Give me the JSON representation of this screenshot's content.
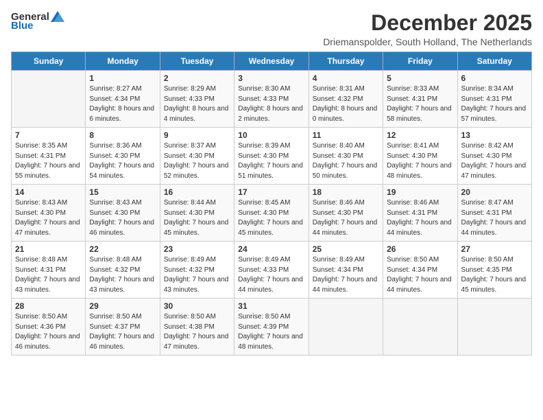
{
  "logo": {
    "general": "General",
    "blue": "Blue"
  },
  "title": "December 2025",
  "subtitle": "Driemanspolder, South Holland, The Netherlands",
  "weekdays": [
    "Sunday",
    "Monday",
    "Tuesday",
    "Wednesday",
    "Thursday",
    "Friday",
    "Saturday"
  ],
  "weeks": [
    [
      {
        "day": "",
        "sunrise": "",
        "sunset": "",
        "daylight": ""
      },
      {
        "day": "1",
        "sunrise": "Sunrise: 8:27 AM",
        "sunset": "Sunset: 4:34 PM",
        "daylight": "Daylight: 8 hours and 6 minutes."
      },
      {
        "day": "2",
        "sunrise": "Sunrise: 8:29 AM",
        "sunset": "Sunset: 4:33 PM",
        "daylight": "Daylight: 8 hours and 4 minutes."
      },
      {
        "day": "3",
        "sunrise": "Sunrise: 8:30 AM",
        "sunset": "Sunset: 4:33 PM",
        "daylight": "Daylight: 8 hours and 2 minutes."
      },
      {
        "day": "4",
        "sunrise": "Sunrise: 8:31 AM",
        "sunset": "Sunset: 4:32 PM",
        "daylight": "Daylight: 8 hours and 0 minutes."
      },
      {
        "day": "5",
        "sunrise": "Sunrise: 8:33 AM",
        "sunset": "Sunset: 4:31 PM",
        "daylight": "Daylight: 7 hours and 58 minutes."
      },
      {
        "day": "6",
        "sunrise": "Sunrise: 8:34 AM",
        "sunset": "Sunset: 4:31 PM",
        "daylight": "Daylight: 7 hours and 57 minutes."
      }
    ],
    [
      {
        "day": "7",
        "sunrise": "Sunrise: 8:35 AM",
        "sunset": "Sunset: 4:31 PM",
        "daylight": "Daylight: 7 hours and 55 minutes."
      },
      {
        "day": "8",
        "sunrise": "Sunrise: 8:36 AM",
        "sunset": "Sunset: 4:30 PM",
        "daylight": "Daylight: 7 hours and 54 minutes."
      },
      {
        "day": "9",
        "sunrise": "Sunrise: 8:37 AM",
        "sunset": "Sunset: 4:30 PM",
        "daylight": "Daylight: 7 hours and 52 minutes."
      },
      {
        "day": "10",
        "sunrise": "Sunrise: 8:39 AM",
        "sunset": "Sunset: 4:30 PM",
        "daylight": "Daylight: 7 hours and 51 minutes."
      },
      {
        "day": "11",
        "sunrise": "Sunrise: 8:40 AM",
        "sunset": "Sunset: 4:30 PM",
        "daylight": "Daylight: 7 hours and 50 minutes."
      },
      {
        "day": "12",
        "sunrise": "Sunrise: 8:41 AM",
        "sunset": "Sunset: 4:30 PM",
        "daylight": "Daylight: 7 hours and 48 minutes."
      },
      {
        "day": "13",
        "sunrise": "Sunrise: 8:42 AM",
        "sunset": "Sunset: 4:30 PM",
        "daylight": "Daylight: 7 hours and 47 minutes."
      }
    ],
    [
      {
        "day": "14",
        "sunrise": "Sunrise: 8:43 AM",
        "sunset": "Sunset: 4:30 PM",
        "daylight": "Daylight: 7 hours and 47 minutes."
      },
      {
        "day": "15",
        "sunrise": "Sunrise: 8:43 AM",
        "sunset": "Sunset: 4:30 PM",
        "daylight": "Daylight: 7 hours and 46 minutes."
      },
      {
        "day": "16",
        "sunrise": "Sunrise: 8:44 AM",
        "sunset": "Sunset: 4:30 PM",
        "daylight": "Daylight: 7 hours and 45 minutes."
      },
      {
        "day": "17",
        "sunrise": "Sunrise: 8:45 AM",
        "sunset": "Sunset: 4:30 PM",
        "daylight": "Daylight: 7 hours and 45 minutes."
      },
      {
        "day": "18",
        "sunrise": "Sunrise: 8:46 AM",
        "sunset": "Sunset: 4:30 PM",
        "daylight": "Daylight: 7 hours and 44 minutes."
      },
      {
        "day": "19",
        "sunrise": "Sunrise: 8:46 AM",
        "sunset": "Sunset: 4:31 PM",
        "daylight": "Daylight: 7 hours and 44 minutes."
      },
      {
        "day": "20",
        "sunrise": "Sunrise: 8:47 AM",
        "sunset": "Sunset: 4:31 PM",
        "daylight": "Daylight: 7 hours and 44 minutes."
      }
    ],
    [
      {
        "day": "21",
        "sunrise": "Sunrise: 8:48 AM",
        "sunset": "Sunset: 4:31 PM",
        "daylight": "Daylight: 7 hours and 43 minutes."
      },
      {
        "day": "22",
        "sunrise": "Sunrise: 8:48 AM",
        "sunset": "Sunset: 4:32 PM",
        "daylight": "Daylight: 7 hours and 43 minutes."
      },
      {
        "day": "23",
        "sunrise": "Sunrise: 8:49 AM",
        "sunset": "Sunset: 4:32 PM",
        "daylight": "Daylight: 7 hours and 43 minutes."
      },
      {
        "day": "24",
        "sunrise": "Sunrise: 8:49 AM",
        "sunset": "Sunset: 4:33 PM",
        "daylight": "Daylight: 7 hours and 44 minutes."
      },
      {
        "day": "25",
        "sunrise": "Sunrise: 8:49 AM",
        "sunset": "Sunset: 4:34 PM",
        "daylight": "Daylight: 7 hours and 44 minutes."
      },
      {
        "day": "26",
        "sunrise": "Sunrise: 8:50 AM",
        "sunset": "Sunset: 4:34 PM",
        "daylight": "Daylight: 7 hours and 44 minutes."
      },
      {
        "day": "27",
        "sunrise": "Sunrise: 8:50 AM",
        "sunset": "Sunset: 4:35 PM",
        "daylight": "Daylight: 7 hours and 45 minutes."
      }
    ],
    [
      {
        "day": "28",
        "sunrise": "Sunrise: 8:50 AM",
        "sunset": "Sunset: 4:36 PM",
        "daylight": "Daylight: 7 hours and 46 minutes."
      },
      {
        "day": "29",
        "sunrise": "Sunrise: 8:50 AM",
        "sunset": "Sunset: 4:37 PM",
        "daylight": "Daylight: 7 hours and 46 minutes."
      },
      {
        "day": "30",
        "sunrise": "Sunrise: 8:50 AM",
        "sunset": "Sunset: 4:38 PM",
        "daylight": "Daylight: 7 hours and 47 minutes."
      },
      {
        "day": "31",
        "sunrise": "Sunrise: 8:50 AM",
        "sunset": "Sunset: 4:39 PM",
        "daylight": "Daylight: 7 hours and 48 minutes."
      },
      {
        "day": "",
        "sunrise": "",
        "sunset": "",
        "daylight": ""
      },
      {
        "day": "",
        "sunrise": "",
        "sunset": "",
        "daylight": ""
      },
      {
        "day": "",
        "sunrise": "",
        "sunset": "",
        "daylight": ""
      }
    ]
  ]
}
